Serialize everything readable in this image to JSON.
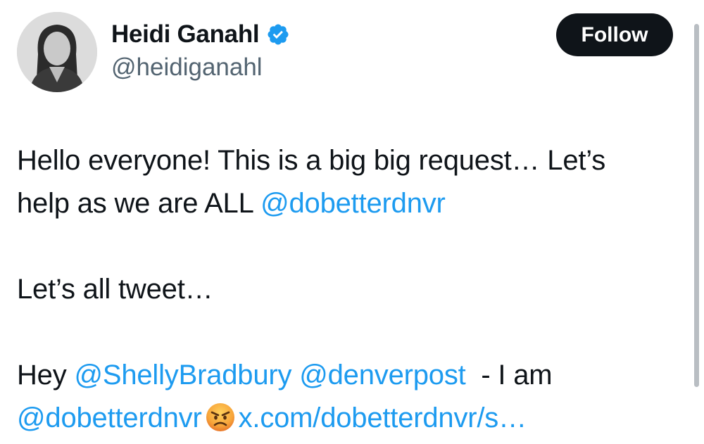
{
  "profile": {
    "display_name": "Heidi Ganahl",
    "handle": "@heidiganahl",
    "verified_icon": "verified-badge-icon",
    "colors": {
      "verified": "#1d9bf0"
    }
  },
  "follow_button": {
    "label": "Follow"
  },
  "tweet": {
    "line1": "Hello everyone! This is a big big request… Let’s",
    "line2_text": "help as we are ALL ",
    "line2_mention": "@dobetterdnvr",
    "line3": "Let’s all tweet…",
    "line4_text": "Hey ",
    "line4_mention1": "@ShellyBradbury",
    "line4_mention2": "@denverpost",
    "line4_tail": "  - I am",
    "line5_mention": "@dobetterdnvr",
    "line5_emoji": "angry-face-emoji",
    "line5_link": "x.com/dobetterdnvr/s…"
  },
  "colors": {
    "link": "#1d9bf0",
    "text": "#0f1419",
    "muted": "#536471",
    "button": "#0f1419"
  }
}
